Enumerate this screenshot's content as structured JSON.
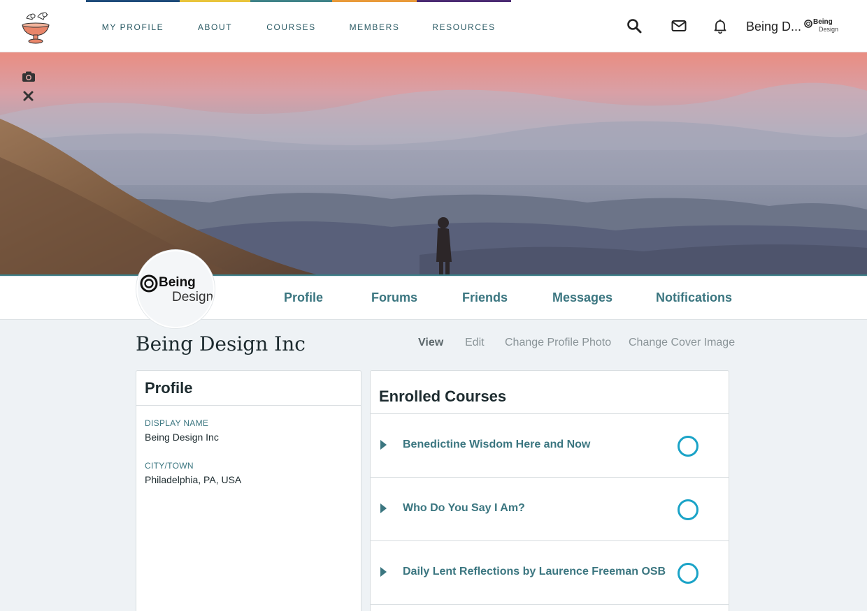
{
  "header": {
    "logo_icon": "bird-fountain-logo",
    "nav": [
      {
        "label": "MY PROFILE"
      },
      {
        "label": "ABOUT"
      },
      {
        "label": "COURSES"
      },
      {
        "label": "MEMBERS"
      },
      {
        "label": "RESOURCES"
      }
    ],
    "search_icon": "search-icon",
    "mail_icon": "mail-icon",
    "bell_icon": "bell-icon",
    "user_name": "Being D...",
    "avatar_text_1": "Being",
    "avatar_text_2": "Design"
  },
  "cover": {
    "camera_icon": "camera-icon",
    "close_icon": "close-icon"
  },
  "profile_tabs": [
    {
      "label": "Profile"
    },
    {
      "label": "Forums"
    },
    {
      "label": "Friends"
    },
    {
      "label": "Messages"
    },
    {
      "label": "Notifications"
    }
  ],
  "avatar": {
    "line1": "Being",
    "line2": "Design"
  },
  "page": {
    "title": "Being Design Inc",
    "actions": [
      {
        "label": "View",
        "active": true
      },
      {
        "label": "Edit"
      },
      {
        "label": "Change Profile Photo"
      },
      {
        "label": "Change Cover Image"
      }
    ]
  },
  "profile_card": {
    "title": "Profile",
    "fields": [
      {
        "label": "DISPLAY NAME",
        "value": "Being Design Inc"
      },
      {
        "label": "CITY/TOWN",
        "value": "Philadelphia, PA, USA"
      }
    ]
  },
  "courses_card": {
    "title": "Enrolled Courses",
    "courses": [
      {
        "name": "Benedictine Wisdom Here and Now"
      },
      {
        "name": "Who Do You Say I Am?"
      },
      {
        "name": "Daily Lent Reflections by Laurence Freeman OSB"
      }
    ]
  },
  "colors": {
    "accent": "#3b7680",
    "progress_ring": "#1aa3c7"
  }
}
